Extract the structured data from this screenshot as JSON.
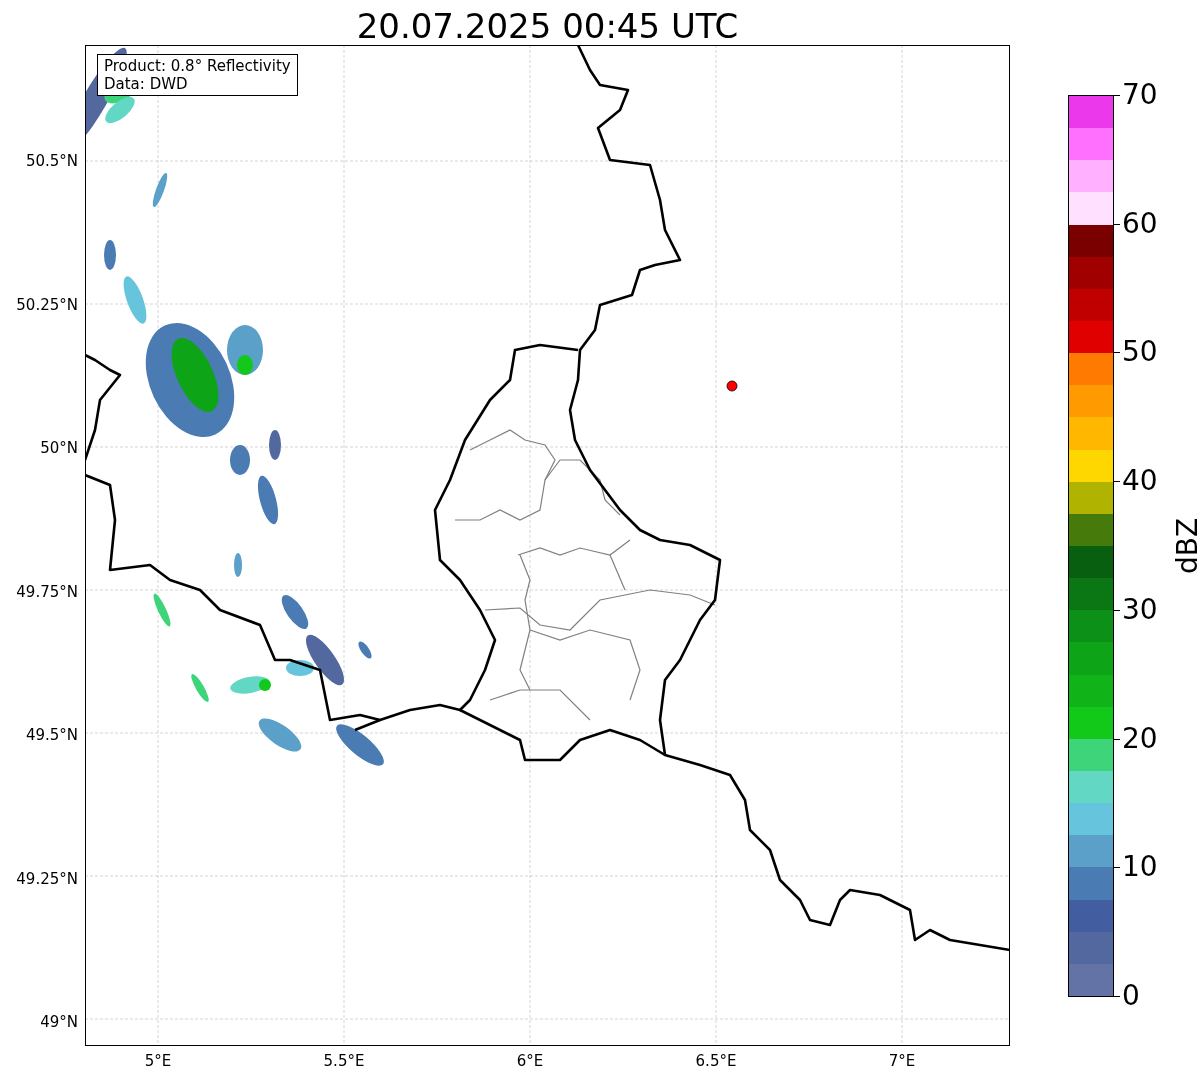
{
  "title": "20.07.2025 00:45 UTC",
  "info_box": {
    "lines": [
      "Product: 0.8° Reflectivity",
      "Data: DWD"
    ]
  },
  "map": {
    "lat_labels": [
      "50.5°N",
      "50.25°N",
      "50°N",
      "49.75°N",
      "49.5°N",
      "49.25°N",
      "49°N"
    ],
    "lon_labels": [
      "5°E",
      "5.5°E",
      "6°E",
      "6.5°E",
      "7°E"
    ]
  },
  "colorbar": {
    "label": "dBZ",
    "ticks": [
      "70",
      "60",
      "50",
      "40",
      "30",
      "20",
      "10",
      "0"
    ],
    "colors": [
      {
        "color": "#ea38ea"
      },
      {
        "color": "#ff70ff"
      },
      {
        "color": "#ffb0ff"
      },
      {
        "color": "#ffe0ff"
      },
      {
        "color": "#7a0000"
      },
      {
        "color": "#a00000"
      },
      {
        "color": "#c00000"
      },
      {
        "color": "#e00000"
      },
      {
        "color": "#ff7a00"
      },
      {
        "color": "#ff9a00"
      },
      {
        "color": "#ffb700"
      },
      {
        "color": "#ffd700"
      },
      {
        "color": "#b0b400"
      },
      {
        "color": "#467a0a"
      },
      {
        "color": "#085f10"
      },
      {
        "color": "#0a7714"
      },
      {
        "color": "#0c9018"
      },
      {
        "color": "#0ea418"
      },
      {
        "color": "#10b418"
      },
      {
        "color": "#12c818"
      },
      {
        "color": "#3dd47a"
      },
      {
        "color": "#62d8c4"
      },
      {
        "color": "#66c4dc"
      },
      {
        "color": "#5aa0c8"
      },
      {
        "color": "#4a7bb3"
      },
      {
        "color": "#425ea0"
      },
      {
        "color": "#5468a0"
      },
      {
        "color": "#6373a5"
      }
    ]
  }
}
